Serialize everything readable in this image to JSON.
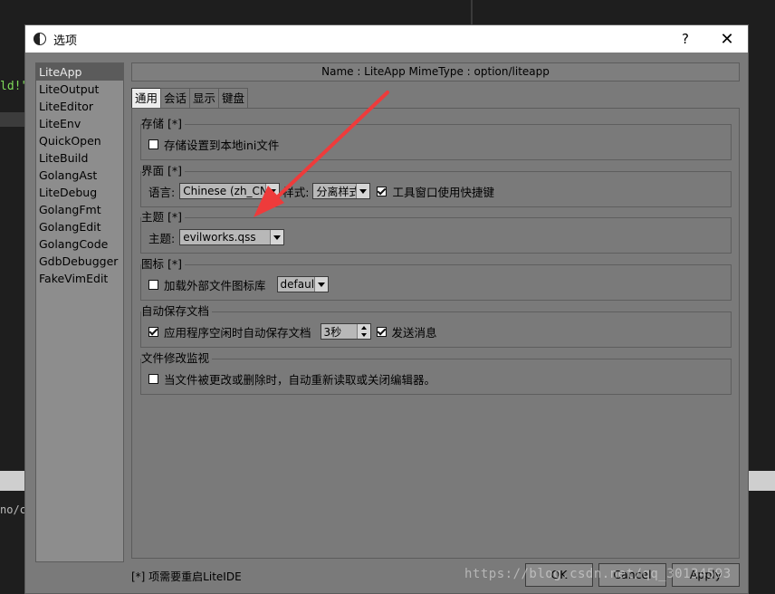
{
  "background": {
    "code_fragment": "ld!\"",
    "code_fragment_2": "no/c"
  },
  "dialog": {
    "title": "选项",
    "help_label": "?",
    "close_label": "✕",
    "categories": [
      "LiteApp",
      "LiteOutput",
      "LiteEditor",
      "LiteEnv",
      "QuickOpen",
      "LiteBuild",
      "GolangAst",
      "LiteDebug",
      "GolangFmt",
      "GolangEdit",
      "GolangCode",
      "GdbDebugger",
      "FakeVimEdit"
    ],
    "selected_category": "LiteApp",
    "header": "Name : LiteApp     MimeType : option/liteapp",
    "tabs": [
      "通用",
      "会话",
      "显示",
      "键盘"
    ],
    "active_tab": "通用",
    "groups": {
      "storage": {
        "title": "存储 [*]",
        "checkbox_label": "存储设置到本地ini文件",
        "checked": false
      },
      "ui": {
        "title": "界面 [*]",
        "language_label": "语言:",
        "language_value": "Chinese (zh_CN)",
        "style_label": "样式:",
        "style_value": "分离样式",
        "toolwindow_label": "工具窗口使用快捷键",
        "toolwindow_checked": true
      },
      "theme": {
        "title": "主题 [*]",
        "theme_label": "主题:",
        "theme_value": "evilworks.qss"
      },
      "icons": {
        "title": "图标 [*]",
        "checkbox_label": "加载外部文件图标库",
        "checked": false,
        "icon_value": "defaul"
      },
      "autosave": {
        "title": "自动保存文档",
        "checkbox_label": "应用程序空闲时自动保存文档",
        "checked": true,
        "interval_value": "3秒",
        "send_label": "发送消息",
        "send_checked": true
      },
      "monitor": {
        "title": "文件修改监视",
        "checkbox_label": "当文件被更改或删除时，自动重新读取或关闭编辑器。",
        "checked": false
      }
    },
    "footer_note": "[*] 项需要重启LiteIDE",
    "buttons": {
      "ok": "OK",
      "cancel": "Cancel",
      "apply": "Apply"
    }
  },
  "watermark": "https://blog.csdn.net/qq_30134593",
  "colors": {
    "dialog_bg": "#7a7a7a",
    "selected_item": "#5b5b5b",
    "annotation_arrow": "#ee3b3b"
  }
}
